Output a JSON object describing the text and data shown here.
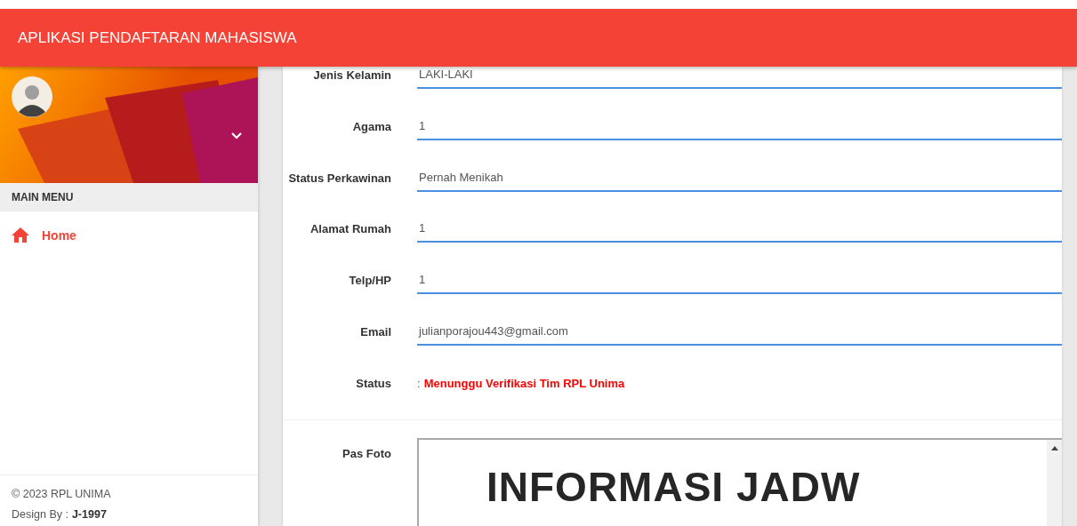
{
  "app_bar": {
    "title": "APLIKASI PENDAFTARAN MAHASISWA"
  },
  "sidebar": {
    "section_title": "MAIN MENU",
    "items": [
      {
        "label": "Home",
        "selected": true
      }
    ],
    "footer": {
      "copyright": "© 2023 RPL UNIMA",
      "design_label": "Design By :",
      "designer": "J-1997"
    }
  },
  "form": {
    "fields": [
      {
        "kind": "field",
        "label": "Jenis Kelamin",
        "value": "LAKI-LAKI"
      },
      {
        "kind": "field",
        "label": "Agama",
        "value": "1"
      },
      {
        "kind": "field",
        "label": "Status Perkawinan",
        "value": "Pernah Menikah"
      },
      {
        "kind": "field",
        "label": "Alamat Rumah",
        "value": "1"
      },
      {
        "kind": "field",
        "label": "Telp/HP",
        "value": "1"
      },
      {
        "kind": "field",
        "label": "Email",
        "value": "julianporajou443@gmail.com"
      },
      {
        "kind": "status",
        "label": "Status",
        "separator": ":",
        "value": "Menunggu Verifikasi Tim RPL Unima"
      }
    ],
    "photo": {
      "label": "Pas Foto",
      "document_heading": "INFORMASI JADW"
    }
  }
}
